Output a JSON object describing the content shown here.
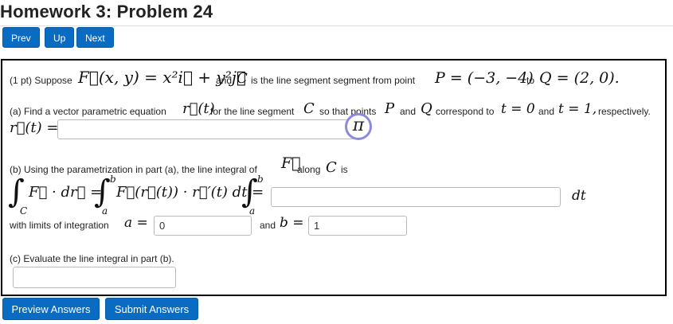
{
  "header": {
    "title": "Homework 3: Problem 24",
    "nav": {
      "prev": "Prev",
      "up": "Up",
      "next": "Next"
    }
  },
  "problem": {
    "intro_pts": "(1 pt) Suppose",
    "intro_F": "F⃗(x, y) = x²i⃗ + y²j⃗",
    "intro_and": "and",
    "intro_C": "C",
    "intro_mid": "is the line segment segment from point",
    "intro_P": "P = (−3, −4)",
    "intro_to": "to",
    "intro_Q": "Q = (2, 0).",
    "part_a_text1": "(a) Find a vector parametric equation",
    "part_a_r": "r⃗(t)",
    "part_a_text2": "for the line segment",
    "part_a_C": "C",
    "part_a_text3": "so that points",
    "part_a_P": "P",
    "part_a_and": "and",
    "part_a_Q": "Q",
    "part_a_text4": "correspond to",
    "part_a_t0": "t = 0",
    "part_a_and2": "and",
    "part_a_t1": "t = 1,",
    "part_a_text5": "respectively.",
    "part_a_label": "r⃗(t) =",
    "part_a_value": "",
    "pi_symbol": "π",
    "part_b_text1": "(b) Using the parametrization in part (a), the line integral of",
    "part_b_F": "F⃗",
    "part_b_text2": "along",
    "part_b_C": "C",
    "part_b_text3": "is",
    "integral_lhs": "∫",
    "integral_lhs_sub": "C",
    "integral_lhs_body": "F⃗ · dr⃗ =",
    "integral_mid": "∫",
    "integral_mid_sup": "b",
    "integral_mid_sub": "a",
    "integral_mid_body": "F⃗(r⃗(t)) · r⃗′(t) dt =",
    "integral_rhs": "∫",
    "integral_rhs_sup": "b",
    "integral_rhs_sub": "a",
    "integrand_value": "",
    "dt": "dt",
    "limits_text": "with limits of integration",
    "limit_a_label": "a =",
    "limit_a_value": "0",
    "limits_and": "and",
    "limit_b_label": "b =",
    "limit_b_value": "1",
    "part_c_text": "(c) Evaluate the line integral in part (b).",
    "part_c_value": ""
  },
  "footer": {
    "preview": "Preview Answers",
    "submit": "Submit Answers"
  },
  "colors": {
    "button": "#0a6bc2",
    "pi_ring": "#8b8bdc"
  }
}
